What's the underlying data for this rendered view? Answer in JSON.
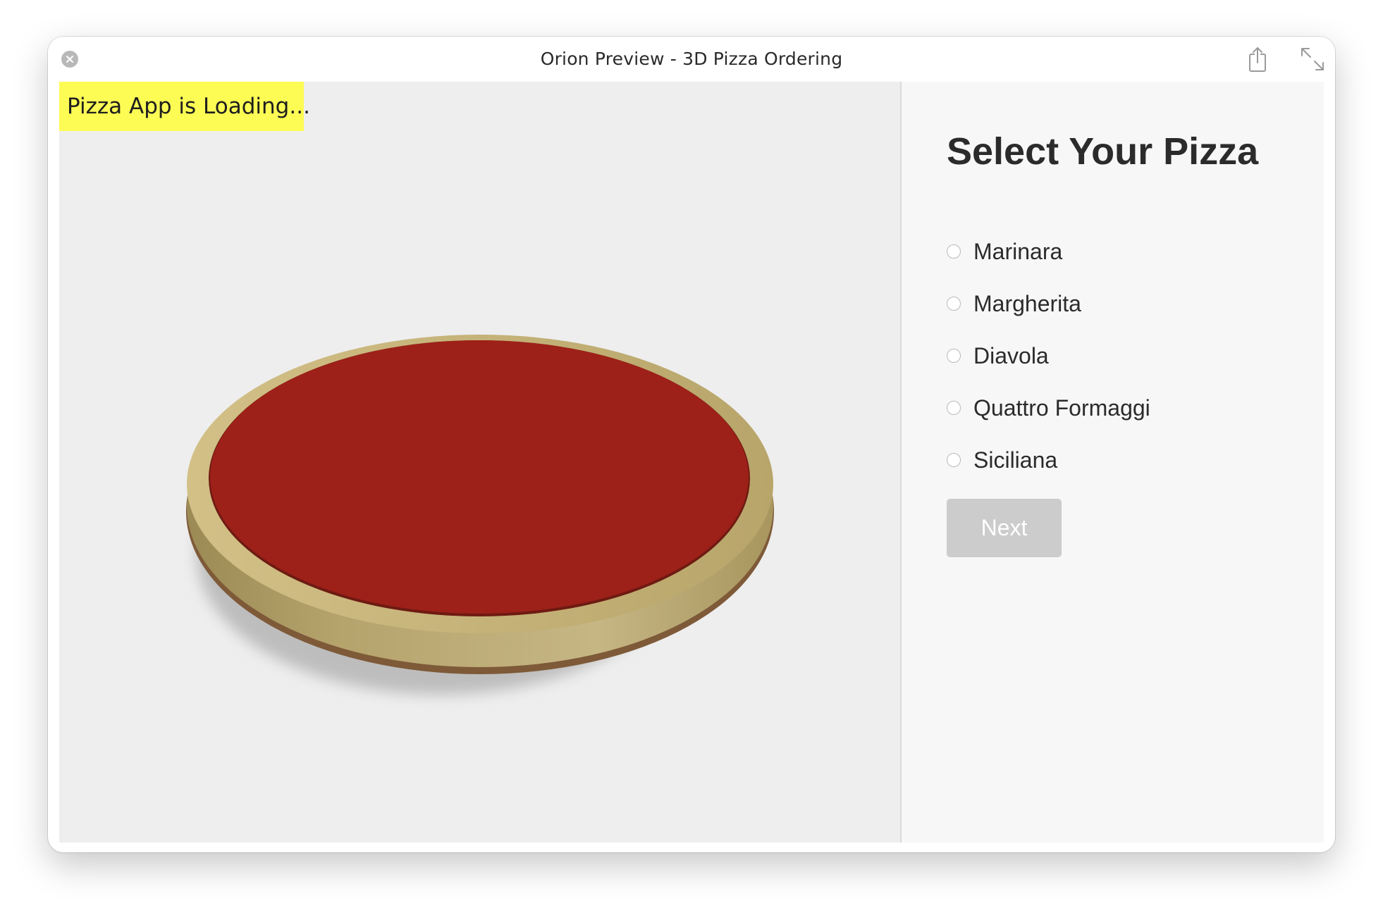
{
  "window": {
    "title": "Orion Preview - 3D Pizza Ordering"
  },
  "titlebar_icons": {
    "close": "close-icon",
    "share": "share-icon",
    "expand": "expand-icon"
  },
  "viewport": {
    "loading_text": "Pizza App is Loading...",
    "loading_bg": "#fdfc54",
    "sauce_color": "#9d2119",
    "crust_color": "#c2b07a"
  },
  "panel": {
    "heading": "Select Your Pizza",
    "options": [
      {
        "label": "Marinara",
        "selected": false
      },
      {
        "label": "Margherita",
        "selected": false
      },
      {
        "label": "Diavola",
        "selected": false
      },
      {
        "label": "Quattro Formaggi",
        "selected": false
      },
      {
        "label": "Siciliana",
        "selected": false
      }
    ],
    "next_label": "Next",
    "next_enabled": false
  }
}
